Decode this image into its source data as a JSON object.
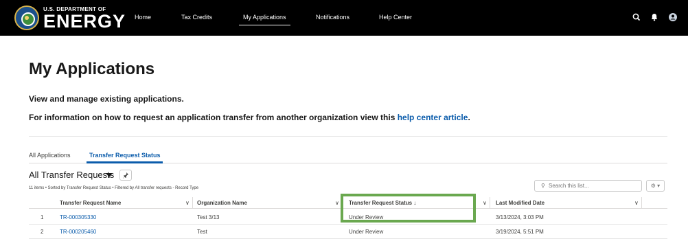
{
  "header": {
    "logo_small": "U.S. DEPARTMENT OF",
    "logo_big": "ENERGY",
    "nav": [
      "Home",
      "Tax Credits",
      "My Applications",
      "Notifications",
      "Help Center"
    ],
    "active_nav": "My Applications",
    "icons": [
      "search-icon",
      "bell-icon",
      "user-avatar-icon"
    ]
  },
  "page": {
    "title": "My Applications",
    "desc1": "View and manage existing applications.",
    "desc2_prefix": "For information on how to request an application transfer from another organization view this ",
    "desc2_link": "help center article",
    "desc2_suffix": "."
  },
  "tabs": [
    "All Applications",
    "Transfer Request Status"
  ],
  "active_tab": "Transfer Request Status",
  "list_view": {
    "title": "All Transfer Requests",
    "meta": "11 items • Sorted by Transfer Request Status • Filtered by All transfer requests - Record Type",
    "search_placeholder": "Search this list..."
  },
  "table": {
    "columns": [
      "Transfer Request Name",
      "Organization Name",
      "Transfer Request Status ↓",
      "Last Modified Date"
    ],
    "rows": [
      {
        "num": "1",
        "name": "TR-000305330",
        "org": "Test 3/13",
        "status": "Under Review",
        "modified": "3/13/2024, 3:03 PM"
      },
      {
        "num": "2",
        "name": "TR-000205460",
        "org": "Test",
        "status": "Under Review",
        "modified": "3/19/2024, 5:51 PM"
      }
    ]
  },
  "colors": {
    "accent": "#0b5cab",
    "highlight": "#6aa84f",
    "topbar": "#000000"
  }
}
